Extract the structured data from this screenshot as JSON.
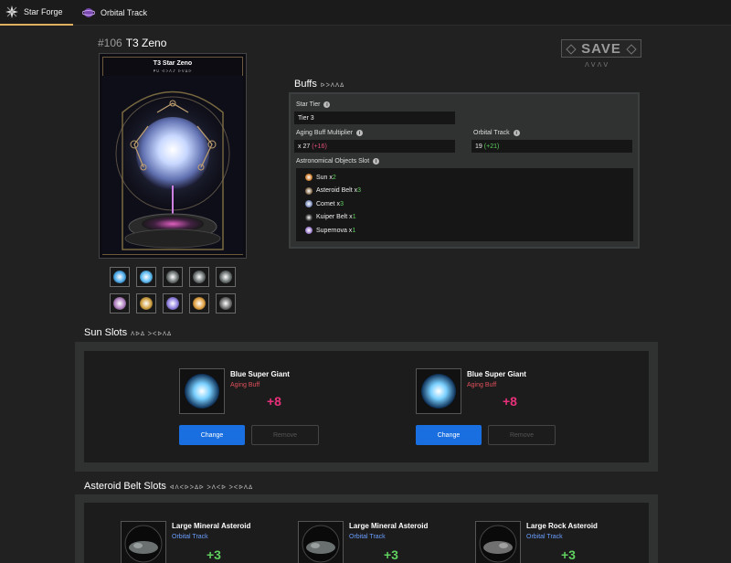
{
  "nav": {
    "tabs": [
      {
        "label": "Star Forge",
        "icon": "star-forge-icon"
      },
      {
        "label": "Orbital Track",
        "icon": "orbital-track-icon"
      }
    ]
  },
  "header": {
    "number": "#106",
    "name": "T3 Zeno",
    "save_label": "SAVE",
    "save_glyph": "ᐱᐯᐱᐯ"
  },
  "card": {
    "title": "T3 Star Zeno",
    "subtitle": "ᑭᑌ ᐊᐳᐱᔑ ᐅᐯᐃᐅ"
  },
  "thumbnails": [
    {
      "icon": "blue-orb-icon",
      "color": "#4aa8e8"
    },
    {
      "icon": "blue-orb-icon",
      "color": "#5ab8f0"
    },
    {
      "icon": "asteroid-icon",
      "color": "#6a7070"
    },
    {
      "icon": "asteroid-icon",
      "color": "#6a7070"
    },
    {
      "icon": "asteroid-icon",
      "color": "#6a7070"
    },
    {
      "icon": "comet-icon",
      "color": "#b080c0"
    },
    {
      "icon": "comet-icon",
      "color": "#d0a040"
    },
    {
      "icon": "comet-icon",
      "color": "#9080e0"
    },
    {
      "icon": "comet-icon",
      "color": "#e0a040"
    },
    {
      "icon": "asteroid-icon",
      "color": "#707070"
    }
  ],
  "buffs": {
    "heading": "Buffs",
    "heading_glyph": "ᐅᐳᐱᐱᐃ",
    "star_tier": {
      "label": "Star Tier",
      "value": "Tier 3"
    },
    "aging": {
      "label": "Aging Buff Multiplier",
      "value": "x 27",
      "bonus": "(+16)"
    },
    "orbital": {
      "label": "Orbital Track",
      "value": "19",
      "bonus": "(+21)"
    },
    "objects_label": "Astronomical Objects Slot",
    "objects": [
      {
        "name": "Sun x",
        "qty": "2",
        "icon": "sun-icon",
        "color": "#d08030"
      },
      {
        "name": "Asteroid Belt x",
        "qty": "3",
        "icon": "asteroid-belt-icon",
        "color": "#8a7050"
      },
      {
        "name": "Comet x",
        "qty": "3",
        "icon": "comet-icon",
        "color": "#8090c0"
      },
      {
        "name": "Kuiper Belt x",
        "qty": "1",
        "icon": "kuiper-belt-icon",
        "color": "#3a3a3a"
      },
      {
        "name": "Supernova x",
        "qty": "1",
        "icon": "supernova-icon",
        "color": "#a080d0"
      }
    ]
  },
  "sun_slots": {
    "heading": "Sun Slots",
    "heading_glyph": "ᐱᐅᐃ ᐳᐸᐅᐱᐃ",
    "slots": [
      {
        "name": "Blue Super Giant",
        "type": "Aging Buff",
        "value": "+8",
        "change": "Change",
        "remove": "Remove"
      },
      {
        "name": "Blue Super Giant",
        "type": "Aging Buff",
        "value": "+8",
        "change": "Change",
        "remove": "Remove"
      }
    ]
  },
  "asteroid_slots": {
    "heading": "Asteroid Belt Slots",
    "heading_glyph": "ᐊᐱᐸᐅᐳᐃᐅ ᐳᐱᐸᐅ ᐳᐸᐅᐱᐃ",
    "slots": [
      {
        "name": "Large Mineral Asteroid",
        "type": "Orbital Track",
        "value": "+3"
      },
      {
        "name": "Large Mineral Asteroid",
        "type": "Orbital Track",
        "value": "+3"
      },
      {
        "name": "Large Rock Asteroid",
        "type": "Orbital Track",
        "value": "+3"
      }
    ]
  }
}
